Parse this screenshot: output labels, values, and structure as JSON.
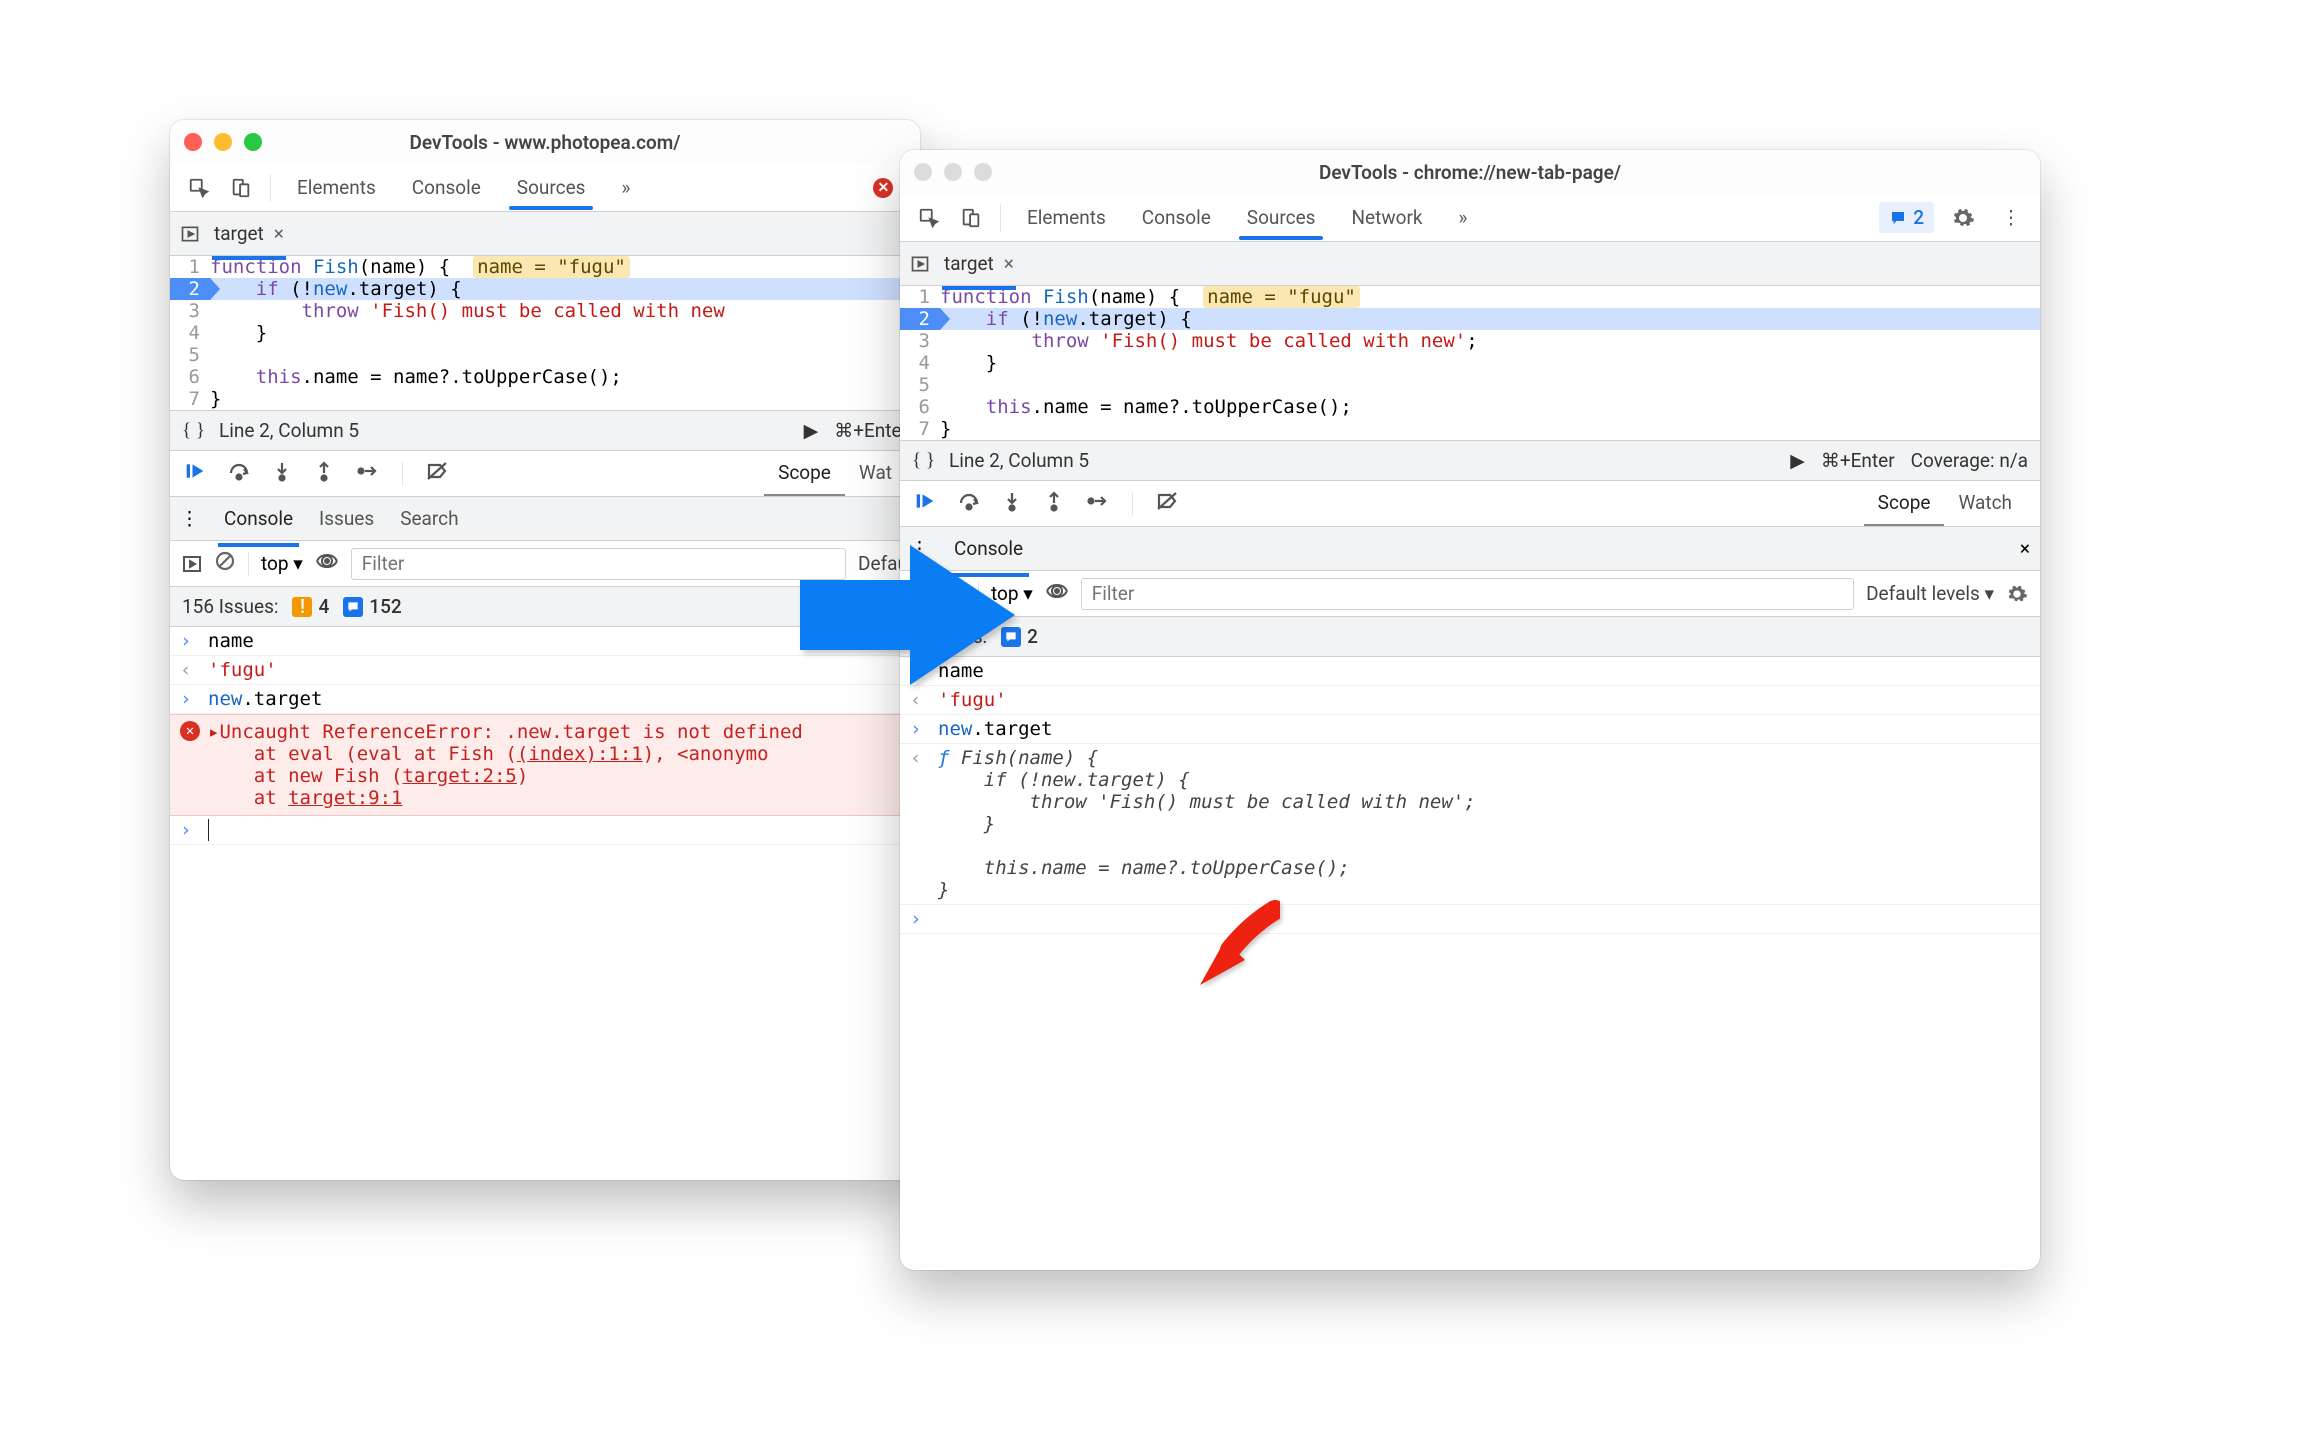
{
  "left": {
    "title": "DevTools - www.photopea.com/",
    "tabs": [
      "Elements",
      "Console",
      "Sources"
    ],
    "active_tab": "Sources",
    "more": "»",
    "error_count": "1",
    "file_tab": "target",
    "code": [
      {
        "n": "1",
        "html": "<span class='kw'>function</span> <span class='new'>Fish</span>(name) {  <span class='name-hint'>name = \"fugu\"</span>"
      },
      {
        "n": "2",
        "html": "    <span class='kw'>if</span> (!<span class='new'>new</span>.target) {",
        "hl": true
      },
      {
        "n": "3",
        "html": "        <span class='kw'>throw</span> <span class='str'>'Fish() must be called with new</span>"
      },
      {
        "n": "4",
        "html": "    }"
      },
      {
        "n": "5",
        "html": ""
      },
      {
        "n": "6",
        "html": "    <span class='kw'>this</span>.name = name?.toUpperCase();"
      },
      {
        "n": "7",
        "html": "}"
      }
    ],
    "braces": "{ }",
    "cursor": "Line 2, Column 5",
    "run_hint": "⌘+Enter",
    "scope": "Scope",
    "watch": "Wat",
    "drawer_tabs": [
      "Console",
      "Issues",
      "Search"
    ],
    "console_context": "top ▾",
    "filter_placeholder": "Filter",
    "levels": "Defau",
    "issues_label": "156 Issues:",
    "issues_warn": "4",
    "issues_info": "152",
    "console_rows": [
      {
        "type": "in",
        "text": "name"
      },
      {
        "type": "out",
        "html": "<span class='str'>'fugu'</span>"
      },
      {
        "type": "in",
        "html": "<span class='new'>new</span>.target"
      }
    ],
    "err_expand": "▸",
    "err_msg": "Uncaught ReferenceError: .new.target is not defined",
    "err_trace": [
      "at eval (eval at Fish (<span class='lnk'>(index):1:1</span>), &lt;anonymo",
      "at new Fish (<span class='lnk'>target:2:5</span>)",
      "at <span class='lnk'>target:9:1</span>"
    ]
  },
  "right": {
    "title": "DevTools - chrome://new-tab-page/",
    "tabs": [
      "Elements",
      "Console",
      "Sources",
      "Network"
    ],
    "active_tab": "Sources",
    "more": "»",
    "feedback_count": "2",
    "file_tab": "target",
    "code": [
      {
        "n": "1",
        "html": "<span class='kw'>function</span> <span class='new'>Fish</span>(name) {  <span class='name-hint'>name = \"fugu\"</span>"
      },
      {
        "n": "2",
        "html": "    <span class='kw'>if</span> (!<span class='new'>new</span>.target) {",
        "hl": true
      },
      {
        "n": "3",
        "html": "        <span class='kw'>throw</span> <span class='str'>'Fish() must be called with new'</span>;"
      },
      {
        "n": "4",
        "html": "    }"
      },
      {
        "n": "5",
        "html": ""
      },
      {
        "n": "6",
        "html": "    <span class='kw'>this</span>.name = name?.toUpperCase();"
      },
      {
        "n": "7",
        "html": "}"
      }
    ],
    "braces": "{ }",
    "cursor": "Line 2, Column 5",
    "run_hint": "⌘+Enter",
    "coverage": "Coverage: n/a",
    "scope": "Scope",
    "watch": "Watch",
    "drawer_tab": "Console",
    "console_context": "top ▾",
    "filter_placeholder": "Filter",
    "levels": "Default levels ▾",
    "issues_label": "2 Issues:",
    "issues_info": "2",
    "console_rows": [
      {
        "type": "in",
        "text": "name"
      },
      {
        "type": "out",
        "html": "<span class='str'>'fugu'</span>"
      },
      {
        "type": "in",
        "html": "<span class='new'>new</span>.target"
      }
    ],
    "func_out": [
      "<span class='f'>ƒ</span> <span class='body'>Fish(name) {</span>",
      "<span class='body'>    if (!new.target) {</span>",
      "<span class='body'>        throw 'Fish() must be called with new';</span>",
      "<span class='body'>    }</span>",
      "<span class='body'></span>",
      "<span class='body'>    this.name = name?.toUpperCase();</span>",
      "<span class='body'>}</span>"
    ]
  }
}
